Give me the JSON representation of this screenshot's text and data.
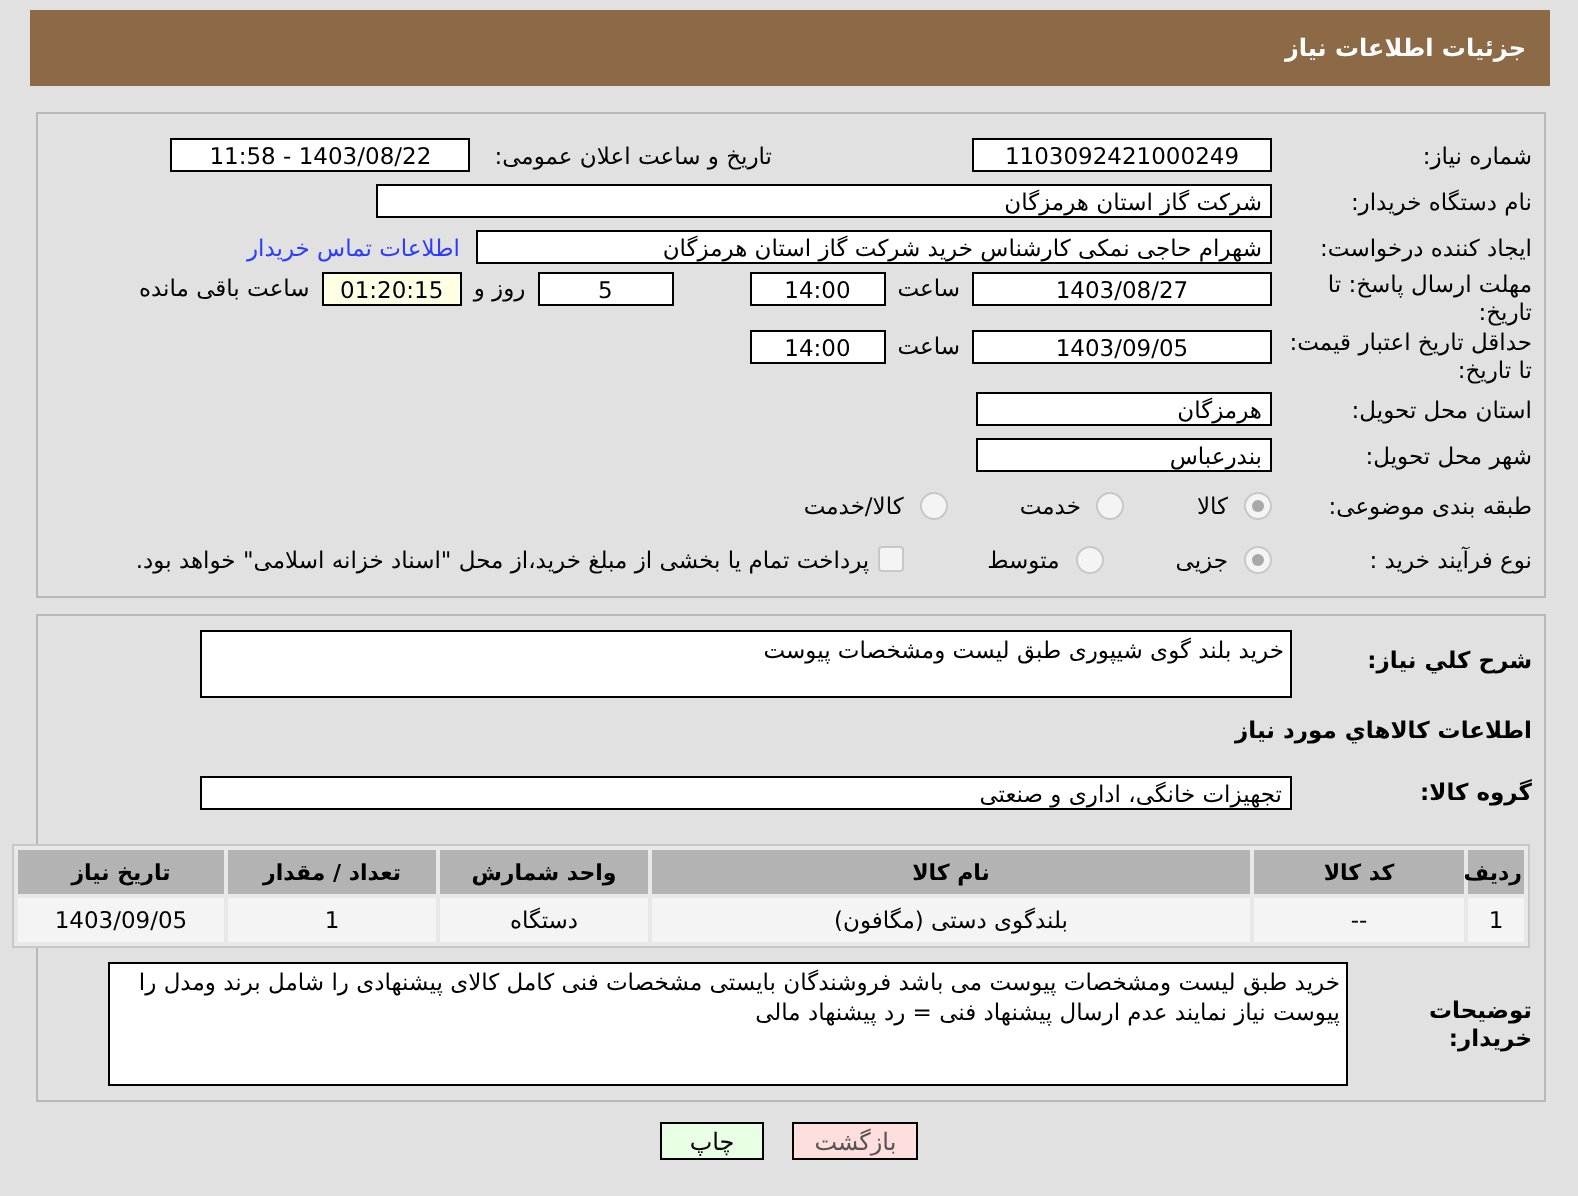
{
  "header": {
    "title": "جزئیات اطلاعات نیاز"
  },
  "need_number": {
    "label": "شماره نیاز:",
    "value": "1103092421000249"
  },
  "announce": {
    "label": "تاریخ و ساعت اعلان عمومی:",
    "value": "1403/08/22 - 11:58"
  },
  "buyer_org": {
    "label": "نام دستگاه خریدار:",
    "value": "شرکت گاز استان هرمزگان"
  },
  "requester": {
    "label": "ایجاد کننده درخواست:",
    "value": "شهرام حاجی نمکی کارشناس خرید شرکت گاز استان هرمزگان",
    "link": "اطلاعات تماس خریدار"
  },
  "deadline": {
    "label": "مهلت ارسال پاسخ: تا تاریخ:",
    "date": "1403/08/27",
    "time_label": "ساعت",
    "time": "14:00",
    "days": "5",
    "days_label": "روز و",
    "remaining": "01:20:15",
    "remaining_label": "ساعت باقی مانده"
  },
  "price_validity": {
    "label": "حداقل تاریخ اعتبار قیمت: تا تاریخ:",
    "date": "1403/09/05",
    "time_label": "ساعت",
    "time": "14:00"
  },
  "province": {
    "label": "استان محل تحویل:",
    "value": "هرمزگان"
  },
  "city": {
    "label": "شهر محل تحویل:",
    "value": "بندرعباس"
  },
  "category": {
    "label": "طبقه بندی موضوعی:",
    "options": [
      {
        "label": "کالا",
        "selected": true
      },
      {
        "label": "خدمت",
        "selected": false
      },
      {
        "label": "کالا/خدمت",
        "selected": false
      }
    ]
  },
  "process": {
    "label": "نوع فرآیند خرید :",
    "options": [
      {
        "label": "جزیی",
        "selected": true
      },
      {
        "label": "متوسط",
        "selected": false
      }
    ],
    "payment_note": {
      "checked": false,
      "text": "پرداخت تمام یا بخشی از مبلغ خرید،از محل \"اسناد خزانه اسلامی\" خواهد بود."
    }
  },
  "description": {
    "label": "شرح کلي نياز:",
    "value": "خرید بلند گوی شیپوری طبق لیست ومشخصات پیوست"
  },
  "goods_heading": "اطلاعات کالاهاي مورد نياز",
  "goods_group": {
    "label": "گروه کالا:",
    "value": "تجهیزات خانگی، اداری و صنعتی"
  },
  "table": {
    "columns": [
      "ردیف",
      "کد کالا",
      "نام کالا",
      "واحد شمارش",
      "تعداد / مقدار",
      "تاریخ نیاز"
    ],
    "rows": [
      [
        "1",
        "--",
        "بلندگوی دستی (مگافون)",
        "دستگاه",
        "1",
        "1403/09/05"
      ]
    ]
  },
  "buyer_notes": {
    "label": "توضیحات خریدار:",
    "value": "خرید طبق لیست ومشخصات پیوست می باشد فروشندگان بایستی مشخصات فنی کامل کالای پیشنهادی را شامل برند ومدل را پیوست نیاز نمایند عدم ارسال پیشنهاد فنی = رد پیشنهاد مالی"
  },
  "buttons": [
    {
      "label": "بازگشت",
      "kind": "back"
    },
    {
      "label": "چاپ",
      "kind": "print"
    }
  ]
}
